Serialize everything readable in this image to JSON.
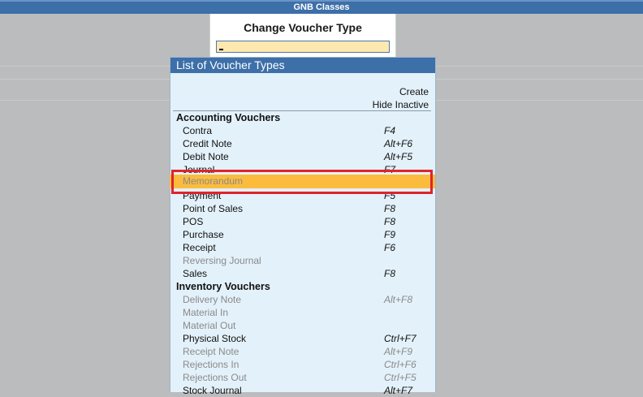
{
  "window": {
    "title": "GNB Classes"
  },
  "change_voucher": {
    "title": "Change Voucher Type",
    "input_value": ""
  },
  "list": {
    "header": "List of Voucher Types",
    "options": [
      "Create",
      "Hide Inactive"
    ],
    "rows": [
      {
        "label": "Accounting Vouchers",
        "key": ""
      },
      {
        "label": "Contra",
        "key": "F4"
      },
      {
        "label": "Credit Note",
        "key": "Alt+F6"
      },
      {
        "label": "Debit Note",
        "key": "Alt+F5"
      },
      {
        "label": "Journal",
        "key": "F7"
      },
      {
        "label": "Memorandum",
        "key": ""
      },
      {
        "label": "Payment",
        "key": "F5"
      },
      {
        "label": "Point of Sales",
        "key": "F8"
      },
      {
        "label": "POS",
        "key": "F8"
      },
      {
        "label": "Purchase",
        "key": "F9"
      },
      {
        "label": "Receipt",
        "key": "F6"
      },
      {
        "label": "Reversing Journal",
        "key": ""
      },
      {
        "label": "Sales",
        "key": "F8"
      },
      {
        "label": "Inventory Vouchers",
        "key": ""
      },
      {
        "label": "Delivery Note",
        "key": "Alt+F8"
      },
      {
        "label": "Material In",
        "key": ""
      },
      {
        "label": "Material Out",
        "key": ""
      },
      {
        "label": "Physical Stock",
        "key": "Ctrl+F7"
      },
      {
        "label": "Receipt Note",
        "key": "Alt+F9"
      },
      {
        "label": "Rejections In",
        "key": "Ctrl+F6"
      },
      {
        "label": "Rejections Out",
        "key": "Ctrl+F5"
      },
      {
        "label": "Stock Journal",
        "key": "Alt+F7"
      }
    ]
  },
  "colors": {
    "accent": "#3d6fa8",
    "highlight": "#fbbc3e",
    "annotation": "#e0232b"
  }
}
